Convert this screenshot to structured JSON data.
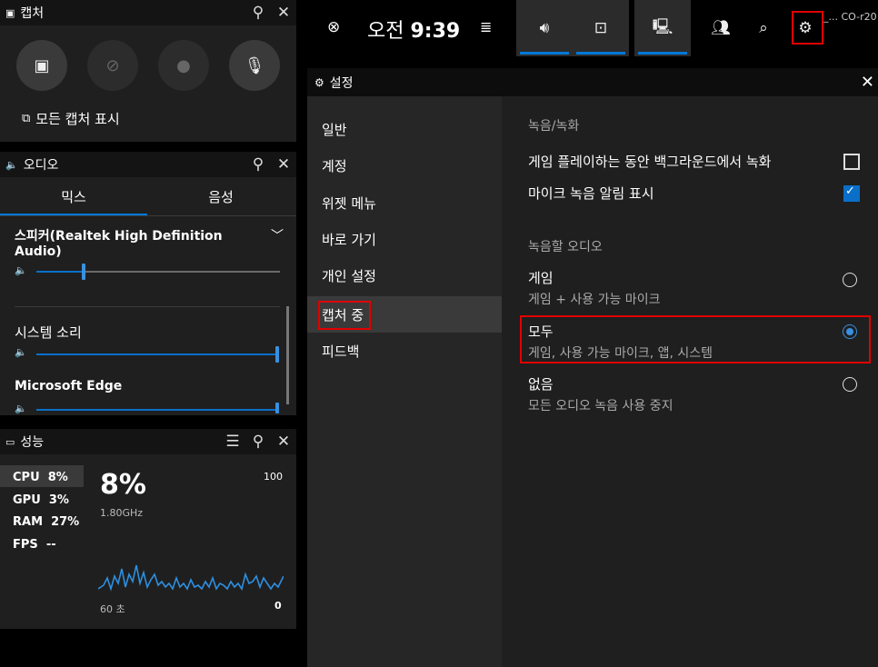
{
  "capture_widget": {
    "title": "캡처",
    "show_all_captures": "모든 캡처 표시"
  },
  "audio_widget": {
    "title": "오디오",
    "tab_mix": "믹스",
    "tab_voice": "음성",
    "output_device": "스피커(Realtek High Definition Audio)",
    "device_volume": 0.2,
    "apps": [
      {
        "name": "시스템 소리",
        "volume": 1.0
      },
      {
        "name": "Microsoft Edge",
        "volume": 1.0
      }
    ]
  },
  "performance_widget": {
    "title": "성능",
    "stats": [
      {
        "label": "CPU",
        "value": "8%"
      },
      {
        "label": "GPU",
        "value": "3%"
      },
      {
        "label": "RAM",
        "value": "27%"
      },
      {
        "label": "FPS",
        "value": "--"
      }
    ],
    "big_value": "8%",
    "freq": "1.80GHz",
    "max": "100",
    "time_label": "60 초",
    "min": "0"
  },
  "topbar": {
    "ampm": "오전",
    "time": "9:39",
    "account": "_... CO-r20"
  },
  "settings": {
    "title": "설정",
    "nav": [
      "일반",
      "계정",
      "위젯 메뉴",
      "바로 가기",
      "개인 설정",
      "캡처 중",
      "피드백"
    ],
    "active_nav_index": 5,
    "section_recording": "녹음/녹화",
    "bg_record": "게임 플레이하는 동안 백그라운드에서 녹화",
    "bg_record_checked": false,
    "mic_notify": "마이크 녹음 알림 표시",
    "mic_notify_checked": true,
    "section_audio": "녹음할 오디오",
    "options": [
      {
        "title": "게임",
        "sub": "게임 + 사용 가능 마이크",
        "selected": false
      },
      {
        "title": "모두",
        "sub": "게임, 사용 가능 마이크, 앱, 시스템",
        "selected": true
      },
      {
        "title": "없음",
        "sub": "모든 오디오 녹음 사용 중지",
        "selected": false
      }
    ]
  }
}
